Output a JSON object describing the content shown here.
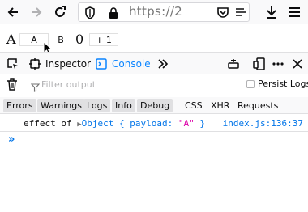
{
  "browser": {
    "url_text": "https://2",
    "icons": {
      "back": "back-arrow-icon",
      "forward": "forward-arrow-icon",
      "reload": "reload-icon",
      "shield": "tracking-shield-icon",
      "lock": "lock-icon",
      "pocket": "pocket-icon",
      "reader": "reader-view-icon",
      "download": "download-icon",
      "menu": "hamburger-menu-icon"
    }
  },
  "app": {
    "a_text": "A",
    "a_box": "A",
    "b_box": "B",
    "count": "0",
    "plus_button": "+ 1"
  },
  "devtools": {
    "tabs": {
      "inspector": "Inspector",
      "console": "Console"
    },
    "filter_placeholder": "Filter output",
    "persist_logs": "Persist Logs",
    "categories": [
      "Errors",
      "Warnings",
      "Logs",
      "Info",
      "Debug",
      "CSS",
      "XHR",
      "Requests"
    ],
    "log": {
      "prefix": "effect of",
      "object_open": "Object { payload: ",
      "string_value": "\"A\"",
      "object_close": " }",
      "source": "index.js:136:37"
    },
    "prompt_symbol": "»"
  },
  "colors": {
    "accent": "#0a84ff",
    "link": "#0074e8",
    "string": "#dd00a9"
  }
}
